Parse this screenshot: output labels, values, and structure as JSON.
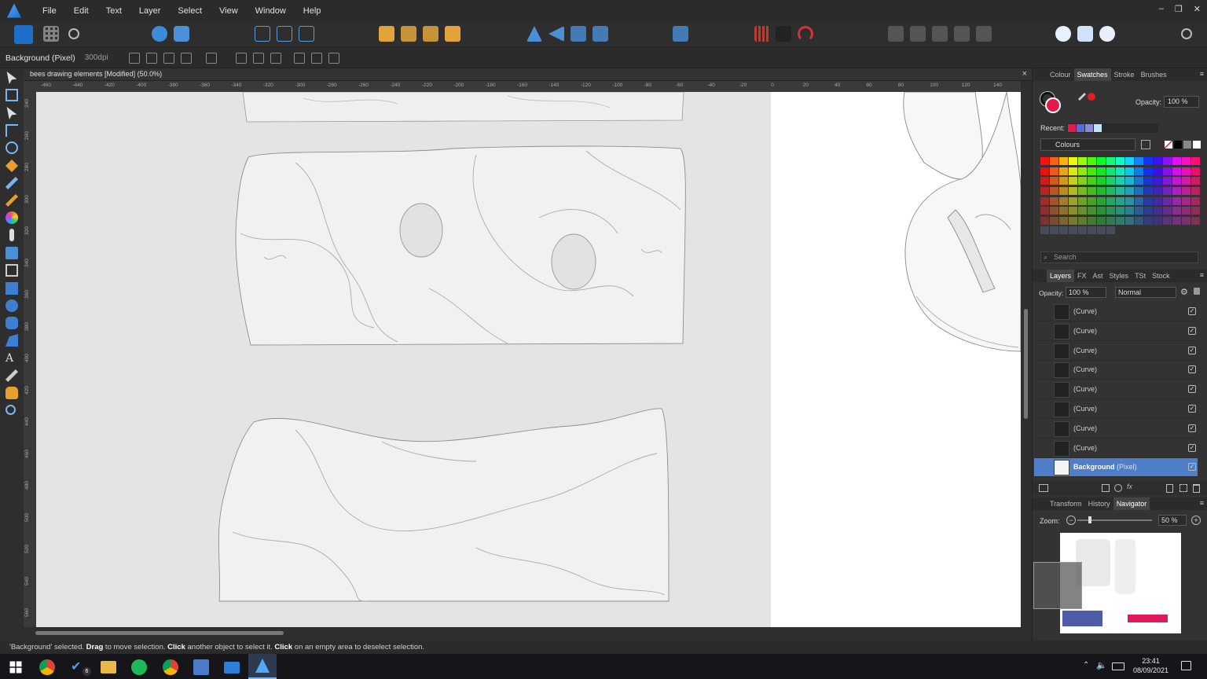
{
  "menubar": {
    "items": [
      "File",
      "Edit",
      "Text",
      "Layer",
      "Select",
      "View",
      "Window",
      "Help"
    ],
    "window_controls": [
      "–",
      "❐",
      "✕"
    ]
  },
  "context_toolbar": {
    "selection_label": "Background (Pixel)",
    "dpi": "300dpi"
  },
  "document": {
    "title": "bees drawing elements [Modified] (50.0%)",
    "close": "×"
  },
  "rulers": {
    "horizontal": [
      "-460",
      "-440",
      "-420",
      "-400",
      "-380",
      "-360",
      "-340",
      "-320",
      "-300",
      "-280",
      "-260",
      "-240",
      "-220",
      "-200",
      "-180",
      "-160",
      "-140",
      "-120",
      "-100",
      "-80",
      "-60",
      "-40",
      "-20",
      "0",
      "20",
      "40",
      "60",
      "80",
      "100",
      "120",
      "140"
    ],
    "vertical": [
      "240",
      "260",
      "280",
      "300",
      "320",
      "340",
      "360",
      "380",
      "400",
      "420",
      "440",
      "460",
      "480",
      "500",
      "520",
      "540",
      "560"
    ]
  },
  "status_bar": {
    "part1": "'Background' selected. ",
    "drag": "Drag",
    "part2": " to move selection. ",
    "click": "Click",
    "part3": " another object to select it. ",
    "click2": "Click",
    "part4": " on an empty area to deselect selection."
  },
  "colour_panel": {
    "tabs": [
      "Colour",
      "Swatches",
      "Stroke",
      "Brushes"
    ],
    "active_tab": "Swatches",
    "opacity_label": "Opacity:",
    "opacity_value": "100 %",
    "recent_label": "Recent:",
    "recent_colors": [
      "#e6194b",
      "#5b6bd6",
      "#8a8ad0",
      "#bfe4ff"
    ],
    "palette_name": "Colours",
    "search_placeholder": "Search",
    "fill_color": "#e6194b"
  },
  "layers_panel": {
    "tabs": [
      "Layers",
      "FX",
      "Ast",
      "Styles",
      "TSt",
      "Stock"
    ],
    "active_tab": "Layers",
    "opacity_label": "Opacity:",
    "opacity_value": "100 %",
    "blend_mode": "Normal",
    "layers": [
      {
        "name": "(Curve)",
        "sub": "",
        "selected": false
      },
      {
        "name": "(Curve)",
        "sub": "",
        "selected": false
      },
      {
        "name": "(Curve)",
        "sub": "",
        "selected": false
      },
      {
        "name": "(Curve)",
        "sub": "",
        "selected": false
      },
      {
        "name": "(Curve)",
        "sub": "",
        "selected": false
      },
      {
        "name": "(Curve)",
        "sub": "",
        "selected": false
      },
      {
        "name": "(Curve)",
        "sub": "",
        "selected": false
      },
      {
        "name": "(Curve)",
        "sub": "",
        "selected": false
      },
      {
        "name": "Background",
        "sub": " (Pixel)",
        "selected": true
      }
    ]
  },
  "navigator_panel": {
    "tabs": [
      "Transform",
      "History",
      "Navigator"
    ],
    "active_tab": "Navigator",
    "zoom_label": "Zoom:",
    "zoom_value": "50 %"
  },
  "taskbar": {
    "time": "23:41",
    "date": "08/09/2021",
    "badge": "6"
  }
}
